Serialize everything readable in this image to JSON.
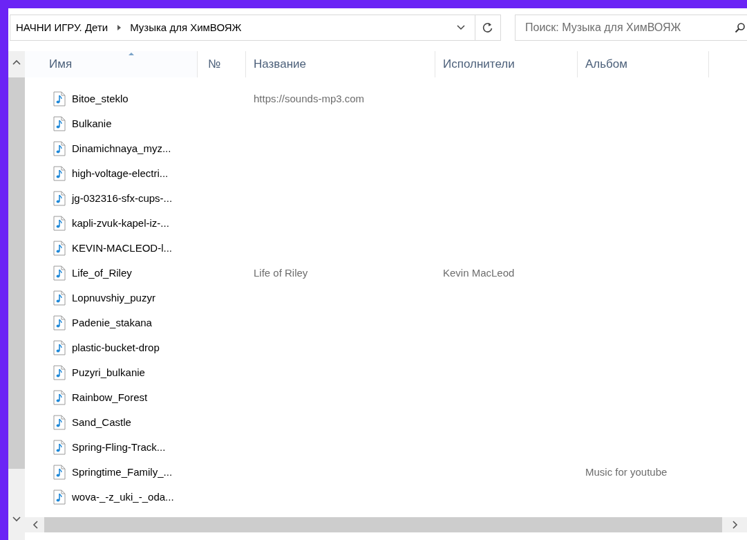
{
  "address_bar": {
    "breadcrumbs": [
      "НАЧНИ ИГРУ. Дети",
      "Музыка для ХимВОЯЖ"
    ]
  },
  "search": {
    "placeholder": "Поиск: Музыка для ХимВОЯЖ"
  },
  "table": {
    "columns": [
      {
        "label": "Имя",
        "sorted": true
      },
      {
        "label": "№",
        "sorted": false
      },
      {
        "label": "Название",
        "sorted": false
      },
      {
        "label": "Исполнители",
        "sorted": false
      },
      {
        "label": "Альбом",
        "sorted": false
      }
    ],
    "rows": [
      {
        "name": "Bitoe_steklo",
        "title": "https://sounds-mp3.com"
      },
      {
        "name": "Bulkanie"
      },
      {
        "name": "Dinamichnaya_myz..."
      },
      {
        "name": "high-voltage-electri..."
      },
      {
        "name": "jg-032316-sfx-cups-..."
      },
      {
        "name": "kapli-zvuk-kapel-iz-..."
      },
      {
        "name": "KEVIN-MACLEOD-l..."
      },
      {
        "name": "Life_of_Riley",
        "title": "Life of Riley",
        "artist": "Kevin MacLeod"
      },
      {
        "name": "Lopnuvshiy_puzyr"
      },
      {
        "name": "Padenie_stakana"
      },
      {
        "name": "plastic-bucket-drop"
      },
      {
        "name": "Puzyri_bulkanie"
      },
      {
        "name": "Rainbow_Forest"
      },
      {
        "name": "Sand_Castle"
      },
      {
        "name": "Spring-Fling-Track..."
      },
      {
        "name": "Springtime_Family_...",
        "album": "Music for youtube"
      },
      {
        "name": "wova-_-z_uki_-_oda..."
      }
    ]
  }
}
